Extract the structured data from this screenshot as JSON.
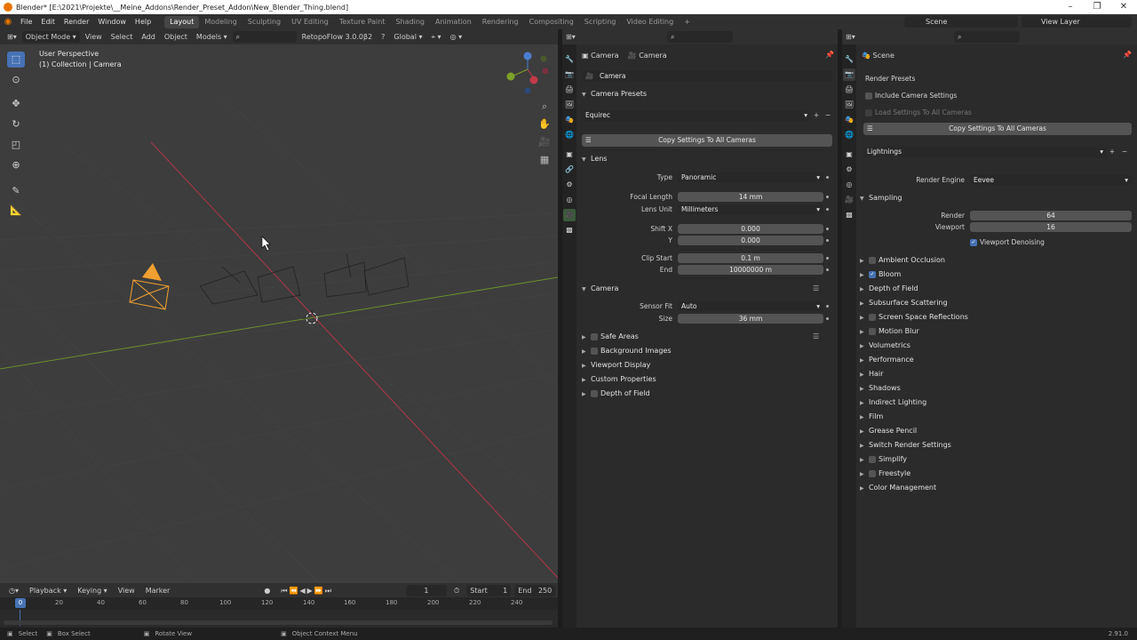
{
  "window": {
    "title": "Blender* [E:\\2021\\Projekte\\__Meine_Addons\\Render_Preset_Addon\\New_Blender_Thing.blend]"
  },
  "menu": [
    "File",
    "Edit",
    "Render",
    "Window",
    "Help"
  ],
  "workspaces": [
    "Layout",
    "Modeling",
    "Sculpting",
    "UV Editing",
    "Texture Paint",
    "Shading",
    "Animation",
    "Rendering",
    "Compositing",
    "Scripting",
    "Video Editing"
  ],
  "scene_name": "Scene",
  "view_layer": "View Layer",
  "viewport_header": {
    "mode": "Object Mode",
    "view": "View",
    "select": "Select",
    "add": "Add",
    "object": "Object",
    "models": "Models",
    "addon": "RetopoFlow 3.0.0β2",
    "orientation": "Global"
  },
  "viewport": {
    "perspective": "User Perspective",
    "collection": "(1) Collection | Camera"
  },
  "timeline": {
    "playback": "Playback",
    "keying": "Keying",
    "view": "View",
    "marker": "Marker",
    "current_frame": "1",
    "start_label": "Start",
    "start": "1",
    "end_label": "End",
    "end": "250",
    "ticks": [
      "0",
      "20",
      "40",
      "60",
      "80",
      "100",
      "120",
      "140",
      "160",
      "180",
      "200",
      "220",
      "240"
    ]
  },
  "status": {
    "select": "Select",
    "box_select": "Box Select",
    "rotate_view": "Rotate View",
    "context_menu": "Object Context Menu",
    "version": "2.91.0"
  },
  "camera_panel": {
    "breadcrumb_obj": "Camera",
    "breadcrumb_data": "Camera",
    "datablock": "Camera",
    "presets_title": "Camera Presets",
    "preset_value": "Equirec",
    "copy_button": "Copy Settings To All Cameras",
    "lens_title": "Lens",
    "type_label": "Type",
    "type_value": "Panoramic",
    "focal_label": "Focal Length",
    "focal_value": "14 mm",
    "lens_unit_label": "Lens Unit",
    "lens_unit_value": "Millimeters",
    "shift_x_label": "Shift X",
    "shift_x_value": "0.000",
    "y_label": "Y",
    "y_value": "0.000",
    "clip_start_label": "Clip Start",
    "clip_start_value": "0.1 m",
    "end_label": "End",
    "end_value": "10000000 m",
    "camera_title": "Camera",
    "sensor_fit_label": "Sensor Fit",
    "sensor_fit_value": "Auto",
    "size_label": "Size",
    "size_value": "36 mm",
    "safe_areas": "Safe Areas",
    "background_images": "Background Images",
    "viewport_display": "Viewport Display",
    "custom_properties": "Custom Properties",
    "depth_of_field": "Depth of Field"
  },
  "render_panel": {
    "breadcrumb": "Scene",
    "render_presets": "Render Presets",
    "include_cameras": "Include Camera Settings",
    "load_settings": "Load Settings To All Cameras",
    "copy_button": "Copy Settings To All Cameras",
    "preset_value": "Lightnings",
    "engine_label": "Render Engine",
    "engine_value": "Eevee",
    "sampling": "Sampling",
    "render_label": "Render",
    "render_value": "64",
    "viewport_label": "Viewport",
    "viewport_value": "16",
    "denoising": "Viewport Denoising",
    "sections": [
      "Ambient Occlusion",
      "Bloom",
      "Depth of Field",
      "Subsurface Scattering",
      "Screen Space Reflections",
      "Motion Blur",
      "Volumetrics",
      "Performance",
      "Hair",
      "Shadows",
      "Indirect Lighting",
      "Film",
      "Grease Pencil",
      "Switch Render Settings",
      "Simplify",
      "Freestyle",
      "Color Management"
    ]
  },
  "colors": {
    "accent": "#4772b3",
    "selected_orange": "#f0a030",
    "x_axis": "#c23a4a",
    "y_axis": "#7da12a"
  }
}
